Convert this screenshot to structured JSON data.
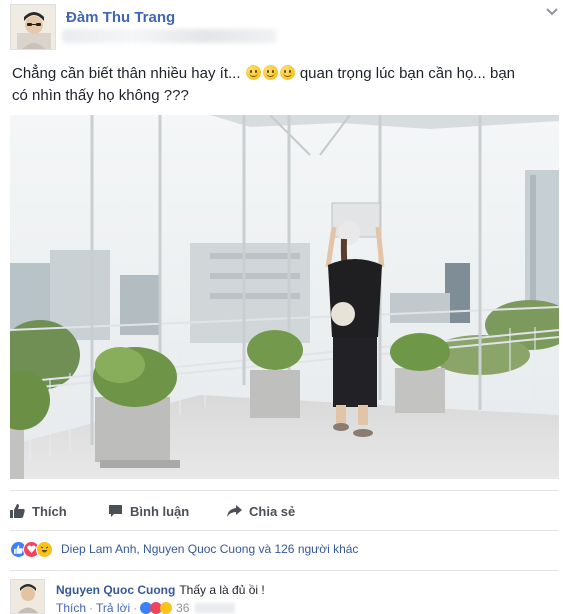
{
  "post": {
    "author": "Đàm Thu Trang",
    "text_line1": "Chẳng cần biết thân nhiều hay ít...",
    "text_mid": "quan trọng lúc bạn cần họ... bạn",
    "text_line2": "có nhìn thấy họ không ???",
    "emoji_count": 3,
    "emoji_icon": "slightly-smiling-face"
  },
  "actions": {
    "like_label": "Thích",
    "comment_label": "Bình luận",
    "share_label": "Chia sẻ"
  },
  "reactions": {
    "icons": [
      "like",
      "love",
      "haha"
    ],
    "summary": "Diep Lam Anh, Nguyen Quoc Cuong và 126 người khác"
  },
  "comment": {
    "author": "Nguyen Quoc Cuong",
    "text": "Thấy a là đủ ồi !",
    "like_label": "Thích",
    "separator": "·",
    "reply_label": "Trả lời",
    "reaction_count": "36"
  },
  "colors": {
    "link_blue": "#4267b2",
    "text": "#1d2129",
    "muted": "#90949c",
    "action_gray": "#4b4f56"
  }
}
